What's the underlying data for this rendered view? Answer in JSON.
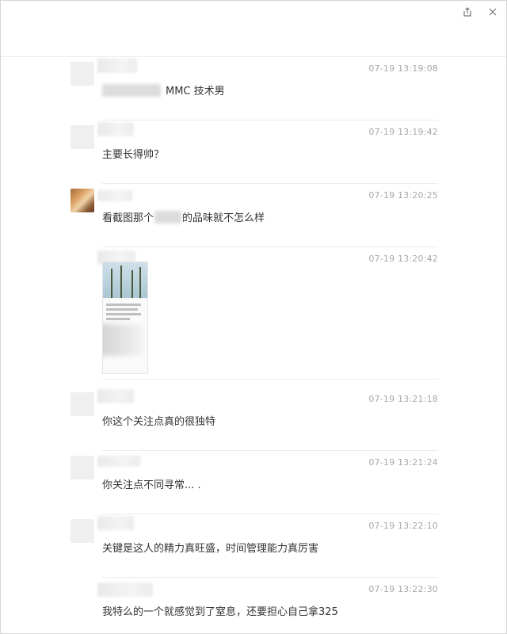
{
  "window": {
    "share_icon": "share-out-icon",
    "close_icon": "close-icon"
  },
  "messages": [
    {
      "time": "07-19 13:19:08",
      "text": "MMC 技术男",
      "avatar": "gray",
      "name_blur_width": "wide"
    },
    {
      "time": "07-19 13:19:42",
      "text": "主要长得帅？",
      "avatar": "gray"
    },
    {
      "time": "07-19 13:20:25",
      "text_before": "看截图那个",
      "text_after": "的品味就不怎么样",
      "avatar": "photo"
    },
    {
      "time": "07-19 13:20:42",
      "image": "screenshot-thumbnail",
      "avatar": "none"
    },
    {
      "time": "07-19 13:21:18",
      "text": "你这个关注点真的很独特",
      "avatar": "gray"
    },
    {
      "time": "07-19 13:21:24",
      "text": "你关注点不同寻常... .",
      "avatar": "gray"
    },
    {
      "time": "07-19 13:22:10",
      "text": "关键是这人的精力真旺盛，时间管理能力真厉害",
      "avatar": "gray"
    },
    {
      "time": "07-19 13:22:30",
      "text": "我特么的一个就感觉到了窒息，还要担心自己拿325",
      "avatar": "none"
    }
  ]
}
